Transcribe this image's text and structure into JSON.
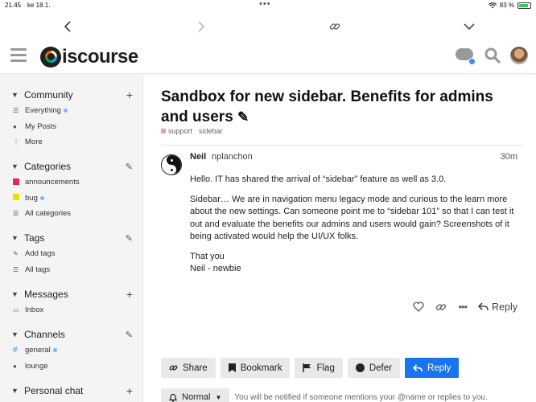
{
  "status_bar": {
    "time": "21.45",
    "date": "ke 18.1.",
    "battery": "83 %"
  },
  "browser": {
    "back_icon": "chevron-left",
    "forward_icon": "chevron-right",
    "link_icon": "link",
    "menu_icon": "chevron-down"
  },
  "header": {
    "logo_text": "iscourse"
  },
  "sidebar": {
    "community": {
      "title": "Community",
      "items": [
        {
          "label": "Everything",
          "icon": "layers",
          "dot": true
        },
        {
          "label": "My Posts",
          "icon": "user"
        },
        {
          "label": "More",
          "icon": "ellipsis-vertical"
        }
      ]
    },
    "categories": {
      "title": "Categories",
      "items": [
        {
          "label": "announcements",
          "color": "#e8246b"
        },
        {
          "label": "bug",
          "color": "#f0dd00",
          "dot": true
        },
        {
          "label": "All categories",
          "icon": "list"
        }
      ]
    },
    "tags": {
      "title": "Tags",
      "items": [
        {
          "label": "Add tags",
          "icon": "pencil"
        },
        {
          "label": "All tags",
          "icon": "list"
        }
      ]
    },
    "messages": {
      "title": "Messages",
      "items": [
        {
          "label": "Inbox",
          "icon": "inbox"
        }
      ]
    },
    "channels": {
      "title": "Channels",
      "items": [
        {
          "label": "general",
          "icon": "hashtag",
          "dot": true
        },
        {
          "label": "lounge",
          "icon": "lock"
        }
      ]
    },
    "personal_chat": {
      "title": "Personal chat"
    }
  },
  "topic": {
    "title": "Sandbox for new sidebar. Benefits for admins and users",
    "tags": [
      "support",
      "sidebar"
    ],
    "post": {
      "name": "Neil",
      "username": "nplanchon",
      "time": "30m",
      "paragraphs": [
        "Hello. IT has shared the arrival of “sidebar” feature as well as 3.0.",
        "Sidebar… We are in navigation menu legacy mode and curious to the learn more about the new settings. Can someone point me to “sidebar 101” so that I can test it out and evaluate the benefits our admins and users would gain? Screenshots of it being activated would help the UI/UX folks.",
        "That you\nNeil - newbie"
      ],
      "reply_label": "Reply"
    },
    "footer_buttons": {
      "share": "Share",
      "bookmark": "Bookmark",
      "flag": "Flag",
      "defer": "Defer",
      "reply": "Reply"
    },
    "notification": {
      "level": "Normal",
      "text": "You will be notified if someone mentions your @name or replies to you."
    }
  }
}
